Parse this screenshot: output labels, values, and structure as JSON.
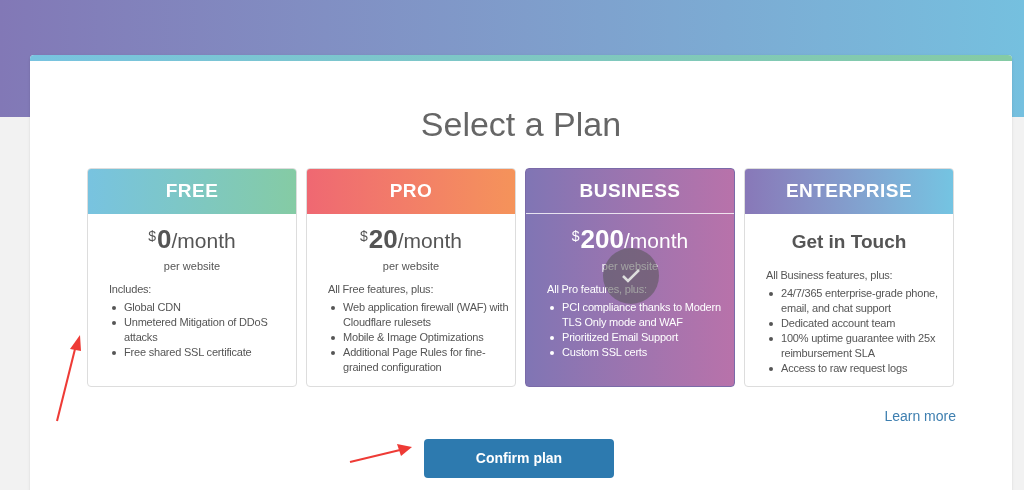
{
  "title": "Select a Plan",
  "plans": [
    {
      "name": "FREE",
      "selected": false,
      "currency": "$",
      "amount": "0",
      "period": "/month",
      "unit": "per website",
      "intro": "Includes:",
      "features": [
        "Global CDN",
        "Unmetered Mitigation of DDoS attacks",
        "Free shared SSL certificate"
      ]
    },
    {
      "name": "PRO",
      "selected": false,
      "currency": "$",
      "amount": "20",
      "period": "/month",
      "unit": "per website",
      "intro": "All Free features, plus:",
      "features": [
        "Web application firewall (WAF) with Cloudflare rulesets",
        "Mobile & Image Optimizations",
        "Additional Page Rules for fine-grained configuration"
      ]
    },
    {
      "name": "BUSINESS",
      "selected": true,
      "currency": "$",
      "amount": "200",
      "period": "/month",
      "unit": "per website",
      "intro": "All Pro features, plus:",
      "features": [
        "PCI compliance thanks to Modern TLS Only mode and WAF",
        "Prioritized Email Support",
        "Custom SSL certs"
      ]
    },
    {
      "name": "ENTERPRISE",
      "selected": false,
      "heading": "Get in Touch",
      "intro": "All Business features, plus:",
      "features": [
        "24/7/365 enterprise-grade phone, email, and chat support",
        "Dedicated account team",
        "100% uptime guarantee with 25x reimbursement SLA",
        "Access to raw request logs"
      ]
    }
  ],
  "learn_more": "Learn more",
  "confirm_button": "Confirm plan"
}
